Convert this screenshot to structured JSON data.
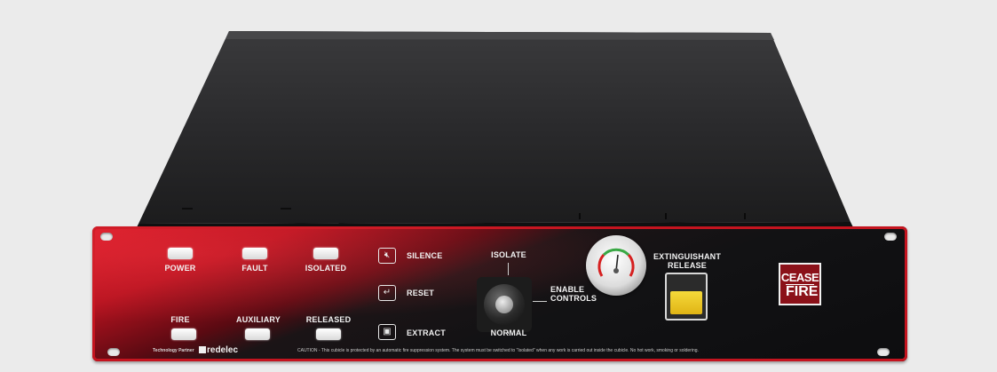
{
  "indicators": {
    "power": "POWER",
    "fault": "FAULT",
    "isolated": "ISOLATED",
    "fire": "FIRE",
    "auxiliary": "AUXILIARY",
    "released": "RELEASED"
  },
  "controls": {
    "silence": "SILENCE",
    "reset": "RESET",
    "extract": "EXTRACT"
  },
  "keyswitch": {
    "isolate": "ISOLATE",
    "normal": "NORMAL",
    "enable_line1": "ENABLE",
    "enable_line2": "CONTROLS"
  },
  "release": {
    "line1": "EXTINGUISHANT",
    "line2": "RELEASE"
  },
  "logo": {
    "line1": "CEASE",
    "line2": "FIRE"
  },
  "footer": {
    "partner": "Technology Partner",
    "brand": "redelec",
    "caution": "CAUTION - This cubicle is protected by an automatic fire suppression system. The system must be switched to \"Isolated\" when any work is carried out inside the cubicle. No hot work, smoking or soldering."
  }
}
